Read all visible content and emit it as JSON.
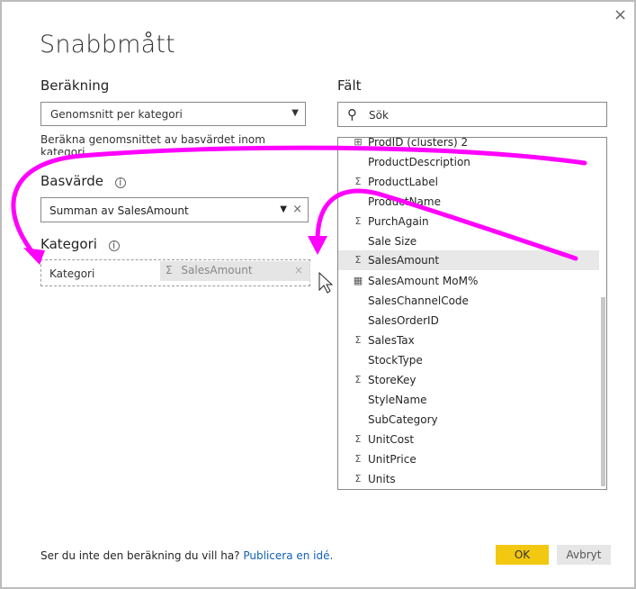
{
  "dialog": {
    "title": "Snabbmått",
    "close_label": "×"
  },
  "calculation": {
    "label": "Beräkning",
    "selected": "Genomsnitt per kategori",
    "description": "Beräkna genomsnittet av basvärdet inom kategori"
  },
  "base_value": {
    "label": "Basvärde",
    "value": "Summan av SalesAmount"
  },
  "category": {
    "label": "Kategori",
    "placeholder": "Kategori",
    "drag_ghost": "SalesAmount"
  },
  "fields": {
    "label": "Fält",
    "search_placeholder": "Sök",
    "items": [
      {
        "icon": "hierarchy-icon",
        "name": "ProdID (clusters) 2"
      },
      {
        "icon": "",
        "name": "ProductDescription"
      },
      {
        "icon": "sigma-icon",
        "name": "ProductLabel"
      },
      {
        "icon": "",
        "name": "ProductName"
      },
      {
        "icon": "sigma-icon",
        "name": "PurchAgain"
      },
      {
        "icon": "",
        "name": "Sale Size"
      },
      {
        "icon": "sigma-icon",
        "name": "SalesAmount"
      },
      {
        "icon": "calculator-icon",
        "name": "SalesAmount MoM%"
      },
      {
        "icon": "",
        "name": "SalesChannelCode"
      },
      {
        "icon": "",
        "name": "SalesOrderID"
      },
      {
        "icon": "sigma-icon",
        "name": "SalesTax"
      },
      {
        "icon": "",
        "name": "StockType"
      },
      {
        "icon": "sigma-icon",
        "name": "StoreKey"
      },
      {
        "icon": "",
        "name": "StyleName"
      },
      {
        "icon": "",
        "name": "SubCategory"
      },
      {
        "icon": "sigma-icon",
        "name": "UnitCost"
      },
      {
        "icon": "sigma-icon",
        "name": "UnitPrice"
      },
      {
        "icon": "sigma-icon",
        "name": "Units"
      }
    ]
  },
  "footer": {
    "prompt": "Ser du inte den beräkning du vill ha?",
    "link": "Publicera en idé.",
    "ok": "OK",
    "cancel": "Avbryt"
  },
  "colors": {
    "annotation_arrow": "#ff00ff",
    "ok_button": "#f2c811",
    "link": "#1062b3"
  }
}
